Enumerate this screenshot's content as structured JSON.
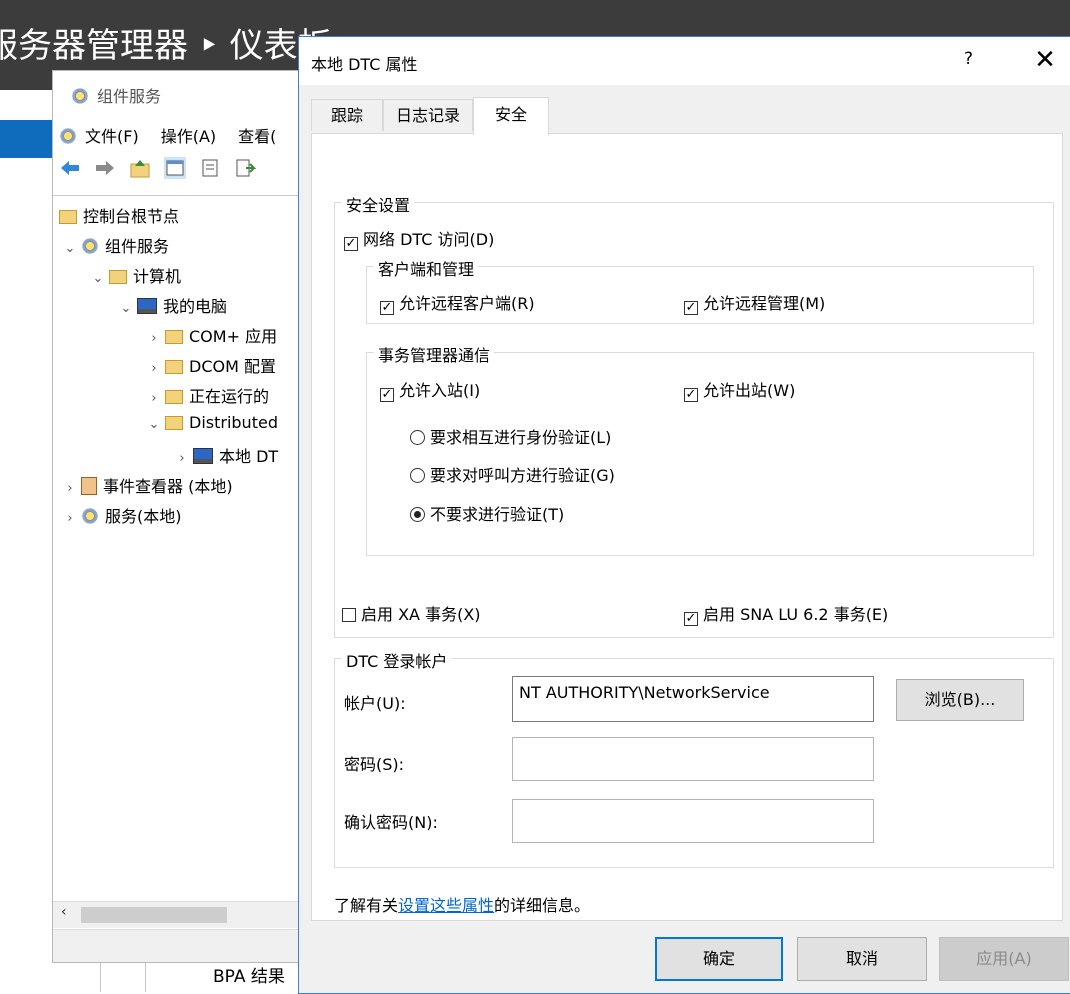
{
  "server_manager": {
    "title": "服务器管理器 ‣ 仪表板",
    "bpa_label": "BPA 结果"
  },
  "mmc": {
    "title": "组件服务",
    "menu": [
      "文件(F)",
      "操作(A)",
      "查看("
    ],
    "tree": [
      {
        "label": "控制台根节点",
        "icon": "folder-icon",
        "expander": ""
      },
      {
        "label": "组件服务",
        "icon": "component-services-icon",
        "expander": "expanded"
      },
      {
        "label": "计算机",
        "icon": "folder-icon",
        "expander": "expanded"
      },
      {
        "label": "我的电脑",
        "icon": "computer-icon",
        "expander": "expanded"
      },
      {
        "label": "COM+ 应用",
        "icon": "folder-icon",
        "expander": "collapsed"
      },
      {
        "label": "DCOM 配置",
        "icon": "folder-icon",
        "expander": "collapsed"
      },
      {
        "label": "正在运行的",
        "icon": "folder-icon",
        "expander": "collapsed"
      },
      {
        "label": "Distributed",
        "icon": "folder-icon",
        "expander": "expanded"
      },
      {
        "label": "本地 DT",
        "icon": "computer-icon",
        "expander": "collapsed"
      },
      {
        "label": "事件查看器 (本地)",
        "icon": "event-viewer-icon",
        "expander": "collapsed"
      },
      {
        "label": "服务(本地)",
        "icon": "services-gear-icon",
        "expander": "collapsed"
      }
    ]
  },
  "dialog": {
    "title": "本地 DTC 属性",
    "help": "?",
    "close": "✕",
    "tabs": [
      {
        "label": "跟踪",
        "active": false
      },
      {
        "label": "日志记录",
        "active": false
      },
      {
        "label": "安全",
        "active": true
      }
    ],
    "security_settings": {
      "legend": "安全设置",
      "network_dtc_access": {
        "label": "网络 DTC 访问(D)",
        "checked": true
      },
      "client_admin": {
        "legend": "客户端和管理",
        "allow_remote_clients": {
          "label": "允许远程客户端(R)",
          "checked": true
        },
        "allow_remote_admin": {
          "label": "允许远程管理(M)",
          "checked": true
        }
      },
      "tm_comm": {
        "legend": "事务管理器通信",
        "allow_inbound": {
          "label": "允许入站(I)",
          "checked": true
        },
        "allow_outbound": {
          "label": "允许出站(W)",
          "checked": true
        },
        "auth_options": [
          {
            "label": "要求相互进行身份验证(L)",
            "selected": false
          },
          {
            "label": "要求对呼叫方进行验证(G)",
            "selected": false
          },
          {
            "label": "不要求进行验证(T)",
            "selected": true
          }
        ]
      },
      "enable_xa": {
        "label": "启用 XA 事务(X)",
        "checked": false
      },
      "enable_sna": {
        "label": "启用 SNA LU 6.2 事务(E)",
        "checked": true
      }
    },
    "logon_account": {
      "legend": "DTC 登录帐户",
      "account_label": "帐户(U):",
      "account_value": "NT AUTHORITY\\NetworkService",
      "browse_label": "浏览(B)...",
      "password_label": "密码(S):",
      "password_value": "",
      "confirm_label": "确认密码(N):",
      "confirm_value": ""
    },
    "info": {
      "prefix": "了解有关",
      "link": "设置这些属性",
      "suffix": "的详细信息。"
    },
    "buttons": {
      "ok": "确定",
      "cancel": "取消",
      "apply": "应用(A)"
    }
  }
}
